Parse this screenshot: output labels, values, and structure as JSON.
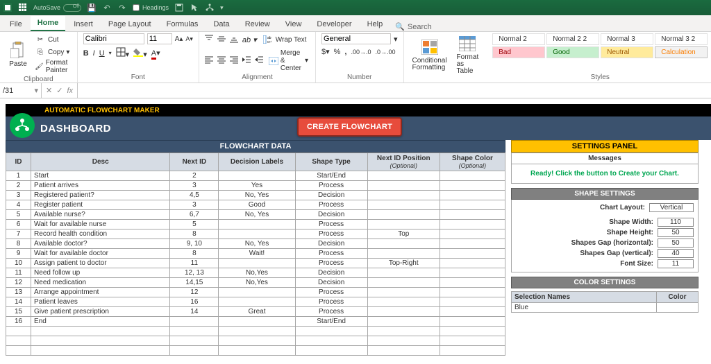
{
  "titlebar": {
    "autosave_label": "AutoSave",
    "autosave_state": "Off",
    "headings_label": "Headings"
  },
  "menu": {
    "items": [
      "File",
      "Home",
      "Insert",
      "Page Layout",
      "Formulas",
      "Data",
      "Review",
      "View",
      "Developer",
      "Help"
    ],
    "active_index": 1,
    "search_label": "Search"
  },
  "ribbon": {
    "clipboard": {
      "paste": "Paste",
      "cut": "Cut",
      "copy": "Copy",
      "format_painter": "Format Painter",
      "label": "Clipboard"
    },
    "font": {
      "name": "Calibri",
      "size": "11",
      "label": "Font"
    },
    "alignment": {
      "wrap": "Wrap Text",
      "merge": "Merge & Center",
      "label": "Alignment"
    },
    "number": {
      "format": "General",
      "label": "Number"
    },
    "cond_fmt": "Conditional\nFormatting",
    "fmt_table": "Format as\nTable",
    "styles": {
      "row1": [
        "Normal 2",
        "Normal 2 2",
        "Normal 3",
        "Normal 3 2"
      ],
      "row2": [
        "Bad",
        "Good",
        "Neutral",
        "Calculation"
      ],
      "label": "Styles"
    }
  },
  "formulabar": {
    "name": "/31",
    "fx": "fx"
  },
  "dashboard": {
    "product": "AUTOMATIC FLOWCHART MAKER",
    "title": "DASHBOARD",
    "create_button": "CREATE FLOWCHART",
    "flow_title": "FLOWCHART DATA",
    "columns": [
      "ID",
      "Desc",
      "Next ID",
      "Decision Labels",
      "Shape Type",
      "Next ID Position",
      "Shape Color"
    ],
    "optional_label": "(Optional)",
    "rows": [
      {
        "id": "1",
        "desc": "Start",
        "next": "2",
        "dec": "",
        "shape": "Start/End",
        "pos": "",
        "color": ""
      },
      {
        "id": "2",
        "desc": "Patient arrives",
        "next": "3",
        "dec": "Yes",
        "shape": "Process",
        "pos": "",
        "color": ""
      },
      {
        "id": "3",
        "desc": "Registered patient?",
        "next": "4,5",
        "dec": "No, Yes",
        "shape": "Decision",
        "pos": "",
        "color": ""
      },
      {
        "id": "4",
        "desc": "Register patient",
        "next": "3",
        "dec": "Good",
        "shape": "Process",
        "pos": "",
        "color": ""
      },
      {
        "id": "5",
        "desc": "Available nurse?",
        "next": "6,7",
        "dec": "No, Yes",
        "shape": "Decision",
        "pos": "",
        "color": ""
      },
      {
        "id": "6",
        "desc": "Wait for available nurse",
        "next": "5",
        "dec": "",
        "shape": "Process",
        "pos": "",
        "color": ""
      },
      {
        "id": "7",
        "desc": "Record health condition",
        "next": "8",
        "dec": "",
        "shape": "Process",
        "pos": "Top",
        "color": ""
      },
      {
        "id": "8",
        "desc": "Available doctor?",
        "next": "9, 10",
        "dec": "No, Yes",
        "shape": "Decision",
        "pos": "",
        "color": ""
      },
      {
        "id": "9",
        "desc": "Wait for available doctor",
        "next": "8",
        "dec": "Wait!",
        "shape": "Process",
        "pos": "",
        "color": ""
      },
      {
        "id": "10",
        "desc": "Assign patient to doctor",
        "next": "11",
        "dec": "",
        "shape": "Process",
        "pos": "Top-Right",
        "color": ""
      },
      {
        "id": "11",
        "desc": "Need follow up",
        "next": "12, 13",
        "dec": "No,Yes",
        "shape": "Decision",
        "pos": "",
        "color": ""
      },
      {
        "id": "12",
        "desc": "Need medication",
        "next": "14,15",
        "dec": "No,Yes",
        "shape": "Decision",
        "pos": "",
        "color": ""
      },
      {
        "id": "13",
        "desc": "Arrange appointment",
        "next": "12",
        "dec": "",
        "shape": "Process",
        "pos": "",
        "color": ""
      },
      {
        "id": "14",
        "desc": "Patient leaves",
        "next": "16",
        "dec": "",
        "shape": "Process",
        "pos": "",
        "color": ""
      },
      {
        "id": "15",
        "desc": "Give patient prescription",
        "next": "14",
        "dec": "Great",
        "shape": "Process",
        "pos": "",
        "color": ""
      },
      {
        "id": "16",
        "desc": "End",
        "next": "",
        "dec": "",
        "shape": "Start/End",
        "pos": "",
        "color": ""
      }
    ],
    "empty_rows": 3
  },
  "settings": {
    "panel_title": "SETTINGS PANEL",
    "messages_label": "Messages",
    "ready_msg": "Ready! Click the button to Create your Chart.",
    "shape_section": "SHAPE SETTINGS",
    "chart_layout_label": "Chart Layout:",
    "chart_layout_value": "Vertical",
    "shape_width_label": "Shape Width:",
    "shape_width_value": "110",
    "shape_height_label": "Shape Height:",
    "shape_height_value": "50",
    "gap_h_label": "Shapes Gap (horizontal):",
    "gap_h_value": "50",
    "gap_v_label": "Shapes Gap (vertical):",
    "gap_v_value": "40",
    "font_size_label": "Font Size:",
    "font_size_value": "11",
    "color_section": "COLOR SETTINGS",
    "color_headers": [
      "Selection Names",
      "Color"
    ],
    "color_rows": [
      {
        "name": "Blue",
        "color": ""
      }
    ]
  }
}
